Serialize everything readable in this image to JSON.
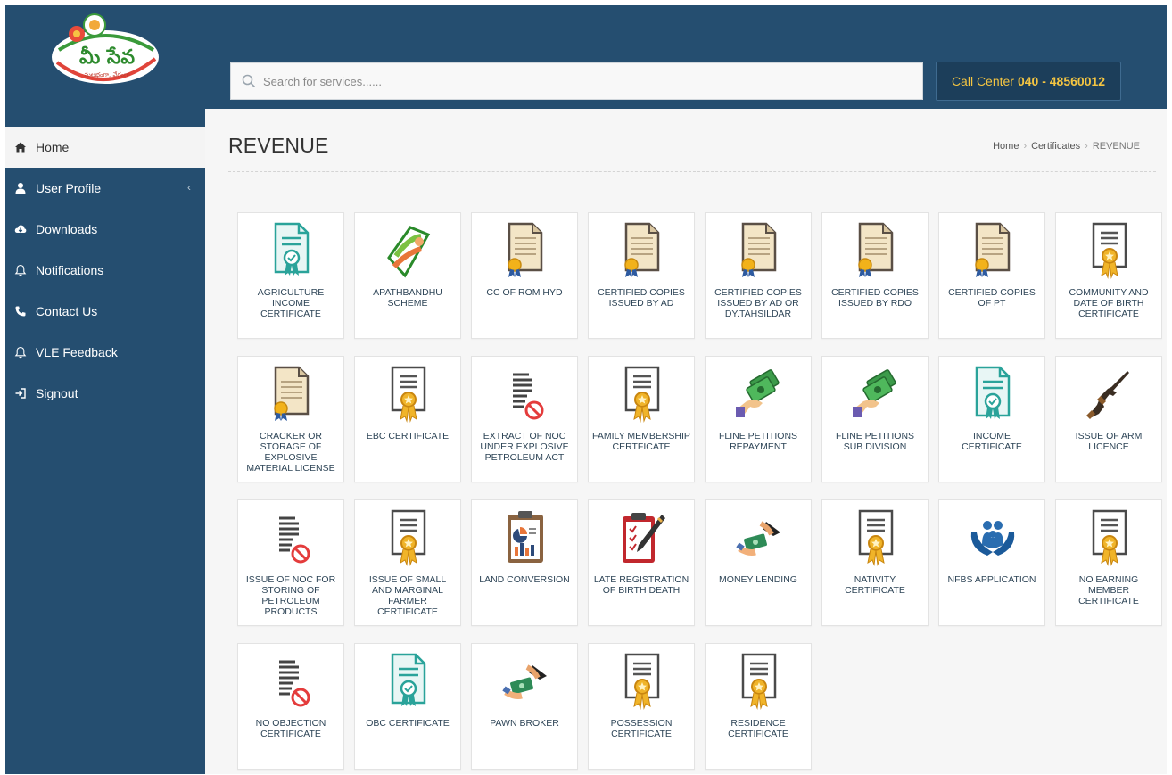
{
  "header": {
    "logo_text": "మీ సేవ",
    "logo_tagline": "సులభంగా, వేగంగా",
    "search_placeholder": "Search for services......",
    "call_center_label": "Call Center",
    "call_center_number": "040 - 48560012"
  },
  "sidebar": {
    "items": [
      {
        "label": "Home",
        "icon": "home-icon"
      },
      {
        "label": "User Profile",
        "icon": "user-icon",
        "chevron": "‹"
      },
      {
        "label": "Downloads",
        "icon": "cloud-download-icon"
      },
      {
        "label": "Notifications",
        "icon": "bell-icon"
      },
      {
        "label": "Contact Us",
        "icon": "phone-icon"
      },
      {
        "label": "VLE Feedback",
        "icon": "bell-icon"
      },
      {
        "label": "Signout",
        "icon": "signout-icon"
      }
    ]
  },
  "main": {
    "title": "REVENUE",
    "breadcrumb": [
      "Home",
      "Certificates",
      "REVENUE"
    ],
    "services": [
      {
        "label": "AGRICULTURE INCOME CERTIFICATE",
        "icon": "teal-certificate-icon"
      },
      {
        "label": "APATHBANDHU SCHEME",
        "icon": "helping-hand-icon"
      },
      {
        "label": "CC OF ROM HYD",
        "icon": "document-ribbon-icon"
      },
      {
        "label": "CERTIFIED COPIES ISSUED BY AD",
        "icon": "document-ribbon-icon"
      },
      {
        "label": "CERTIFIED COPIES ISSUED BY AD OR DY.TAHSILDAR",
        "icon": "document-ribbon-icon"
      },
      {
        "label": "CERTIFIED COPIES ISSUED BY RDO",
        "icon": "document-ribbon-icon"
      },
      {
        "label": "CERTIFIED COPIES OF PT",
        "icon": "document-ribbon-icon"
      },
      {
        "label": "COMMUNITY AND DATE OF BIRTH CERTIFICATE",
        "icon": "certificate-medal-icon"
      },
      {
        "label": "CRACKER OR STORAGE OF EXPLOSIVE MATERIAL LICENSE",
        "icon": "document-ribbon-icon"
      },
      {
        "label": "EBC CERTIFICATE",
        "icon": "certificate-medal-icon"
      },
      {
        "label": "EXTRACT OF NOC UNDER EXPLOSIVE PETROLEUM ACT",
        "icon": "no-document-icon"
      },
      {
        "label": "FAMILY MEMBERSHIP CERTFICATE",
        "icon": "certificate-medal-icon"
      },
      {
        "label": "FLINE PETITIONS REPAYMENT",
        "icon": "cash-hand-icon"
      },
      {
        "label": "FLINE PETITIONS SUB DIVISION",
        "icon": "cash-hand-icon"
      },
      {
        "label": "INCOME CERTIFICATE",
        "icon": "teal-certificate-icon"
      },
      {
        "label": "ISSUE OF ARM LICENCE",
        "icon": "rifle-icon"
      },
      {
        "label": "ISSUE OF NOC FOR STORING OF PETROLEUM PRODUCTS",
        "icon": "no-document-icon"
      },
      {
        "label": "ISSUE OF SMALL AND MARGINAL FARMER CERTIFICATE",
        "icon": "certificate-medal-icon"
      },
      {
        "label": "LAND CONVERSION",
        "icon": "clipboard-chart-icon"
      },
      {
        "label": "LATE REGISTRATION OF BIRTH DEATH",
        "icon": "clipboard-pen-icon"
      },
      {
        "label": "MONEY LENDING",
        "icon": "money-exchange-icon"
      },
      {
        "label": "NATIVITY CERTIFICATE",
        "icon": "certificate-medal-icon"
      },
      {
        "label": "NFBS APPLICATION",
        "icon": "family-hands-icon"
      },
      {
        "label": "NO EARNING MEMBER CERTIFICATE",
        "icon": "certificate-medal-icon"
      },
      {
        "label": "NO OBJECTION CERTIFICATE",
        "icon": "no-document-icon"
      },
      {
        "label": "OBC CERTIFICATE",
        "icon": "teal-certificate-icon"
      },
      {
        "label": "PAWN BROKER",
        "icon": "money-exchange-icon"
      },
      {
        "label": "POSSESSION CERTIFICATE",
        "icon": "certificate-medal-icon"
      },
      {
        "label": "RESIDENCE CERTIFICATE",
        "icon": "certificate-medal-icon"
      }
    ]
  },
  "colors": {
    "header_bg": "#254e70",
    "call_center_text": "#f4c542",
    "tile_label": "#2e4557"
  }
}
